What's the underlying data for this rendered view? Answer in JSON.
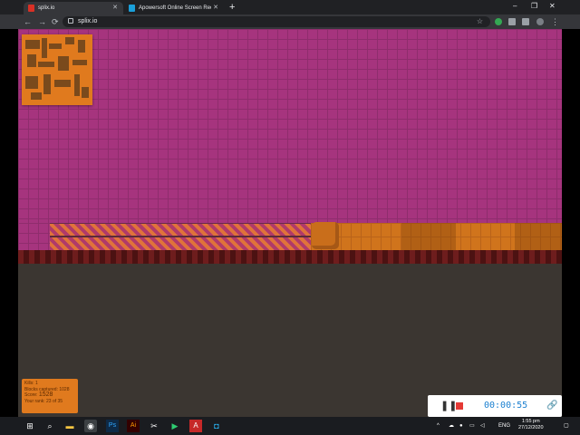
{
  "browser": {
    "tabs": [
      {
        "title": "splix.io",
        "active": true
      },
      {
        "title": "Apowersoft Online Screen Recor",
        "active": false
      }
    ],
    "new_tab": "+",
    "window_controls": {
      "minimize": "–",
      "maximize": "❐",
      "close": "✕"
    },
    "nav": {
      "back": "←",
      "forward": "→",
      "reload": "⟳"
    },
    "address": "splix.io",
    "star": "☆",
    "menu": "⋮"
  },
  "game": {
    "stats": {
      "kills": "Kills: 1",
      "blocks": "Blocks captured: 1028",
      "score_label": "Score:",
      "score_value": "1528",
      "rank": "Your rank: 23 of 35"
    }
  },
  "recorder": {
    "pause": "❚❚",
    "timer": "00:00:55",
    "link": "🔗"
  },
  "taskbar": {
    "tray_lang": "ENG",
    "time": "1:55 pm",
    "date": "27/12/2020"
  },
  "colors": {
    "enemy_territory": "#a6347e",
    "player": "#d0741c",
    "outside": "#3b3631",
    "border": "#5c1616"
  }
}
